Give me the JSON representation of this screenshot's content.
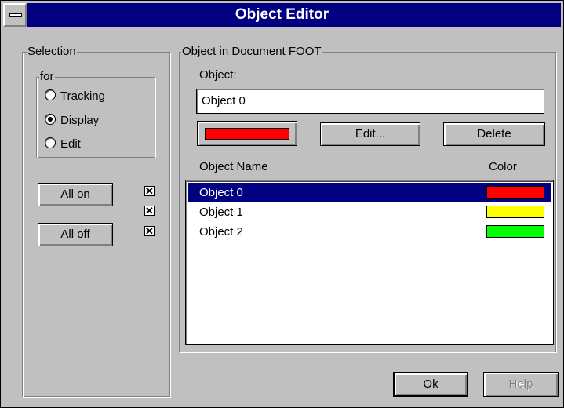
{
  "window": {
    "title": "Object Editor"
  },
  "selection": {
    "group_label": "Selection",
    "for_label": "for",
    "options": [
      {
        "label": "Tracking",
        "checked": false
      },
      {
        "label": "Display",
        "checked": true
      },
      {
        "label": "Edit",
        "checked": false
      }
    ],
    "all_on_label": "All on",
    "all_off_label": "All off",
    "checkboxes": [
      {
        "mark": "✕",
        "checked": true
      },
      {
        "mark": "✕",
        "checked": true
      },
      {
        "mark": "✕",
        "checked": true
      }
    ]
  },
  "object_panel": {
    "group_label": "Object in Document FOOT",
    "object_label": "Object:",
    "object_value": "Object 0",
    "current_color": "#ff0000",
    "edit_label": "Edit...",
    "delete_label": "Delete",
    "col_name": "Object Name",
    "col_color": "Color",
    "objects": [
      {
        "name": "Object 0",
        "color": "#ff0000",
        "selected": true
      },
      {
        "name": "Object 1",
        "color": "#ffff00",
        "selected": false
      },
      {
        "name": "Object 2",
        "color": "#00ff00",
        "selected": false
      }
    ]
  },
  "footer": {
    "ok_label": "Ok",
    "help_label": "Help"
  }
}
